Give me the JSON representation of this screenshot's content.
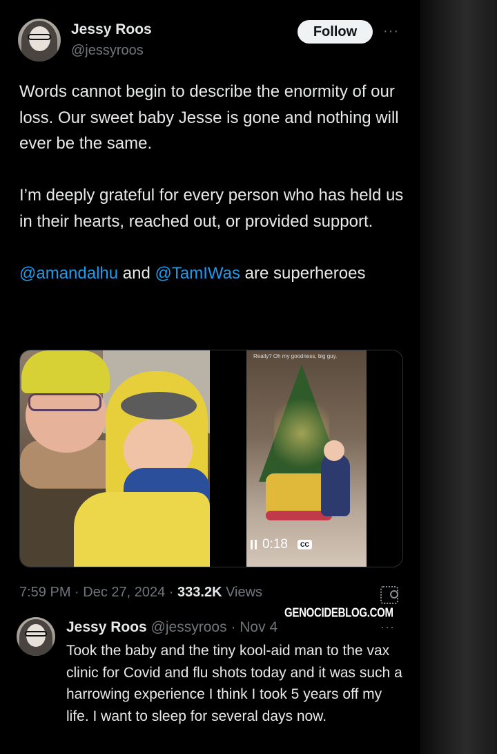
{
  "tweet": {
    "author_name": "Jessy Roos",
    "author_handle": "@jessyroos",
    "follow_label": "Follow",
    "more_label": "···",
    "paragraph_1": "Words cannot begin to describe the enormity of our loss. Our sweet baby Jesse is gone and nothing will ever be the same.",
    "paragraph_2": "I’m deeply grateful for every person who has held us in their hearts, reached out, or provided support.",
    "mention_1": "@amandalhu",
    "connector": " and ",
    "mention_2": "@TamIWas",
    "paragraph_3_tail": " are superheroes",
    "video": {
      "caption": "Really? Oh my goodness, big guy.",
      "time": "0:18",
      "cc_label": "CC"
    },
    "timestamp": "7:59 PM · Dec 27, 2024 · ",
    "views_count": "333.2K",
    "views_label": " Views"
  },
  "watermark": "GENOCIDEBLOG.COM",
  "quoted": {
    "author_name": "Jessy Roos",
    "author_handle": "@jessyroos",
    "date": "· Nov 4",
    "more_label": "···",
    "text": "Took the baby and the tiny kool-aid man to the vax clinic for Covid and flu shots today and it was such a harrowing experience I think I took 5 years off my life. I want to sleep for several days now."
  },
  "colors": {
    "background": "#000000",
    "text": "#e7e9ea",
    "secondary": "#71767b",
    "link": "#1d9bf0"
  }
}
